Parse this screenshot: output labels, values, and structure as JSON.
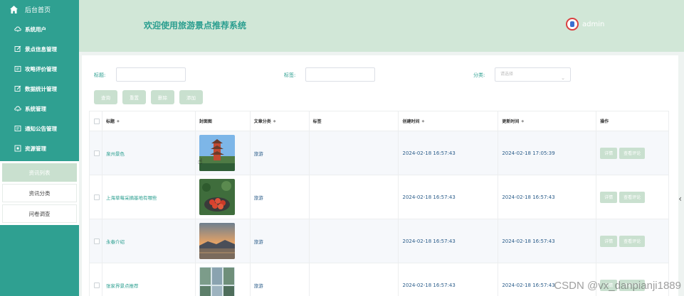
{
  "sidebar": {
    "home": {
      "label": "后台首页",
      "icon": "home-icon"
    },
    "items": [
      {
        "label": "系统用户",
        "icon": "cloud-icon"
      },
      {
        "label": "景点信息管理",
        "icon": "edit-icon"
      },
      {
        "label": "攻略评价管理",
        "icon": "doc-icon"
      },
      {
        "label": "数据统计管理",
        "icon": "edit-icon"
      },
      {
        "label": "系统管理",
        "icon": "cloud-icon"
      },
      {
        "label": "通知公告管理",
        "icon": "doc-icon"
      },
      {
        "label": "资源管理",
        "icon": "box-icon"
      }
    ],
    "sub_items": [
      {
        "label": "资讯列表",
        "active": true
      },
      {
        "label": "资讯分类",
        "active": false
      },
      {
        "label": "问卷调查",
        "active": false
      }
    ]
  },
  "header": {
    "title": "欢迎使用旅游景点推荐系统",
    "user": "admin"
  },
  "filters": {
    "title_label": "标题:",
    "tag_label": "标签:",
    "category_label": "分类:",
    "category_placeholder": "请选择"
  },
  "actions": {
    "query": "查询",
    "reset": "重置",
    "delete": "删除",
    "add": "添加"
  },
  "table": {
    "columns": [
      "标题",
      "封面图",
      "文章分类",
      "标签",
      "创建时间",
      "更新时间",
      "操作"
    ],
    "rows": [
      {
        "title": "泉州景色",
        "category": "旅游",
        "tag": "",
        "created": "2024-02-18 16:57:43",
        "updated": "2024-02-18 17:05:39",
        "cover": "pagoda"
      },
      {
        "title": "上海草莓采摘基地有哪些",
        "category": "旅游",
        "tag": "",
        "created": "2024-02-18 16:57:43",
        "updated": "2024-02-18 16:57:43",
        "cover": "strawberry"
      },
      {
        "title": "永春介绍",
        "category": "旅游",
        "tag": "",
        "created": "2024-02-18 16:57:43",
        "updated": "2024-02-18 16:57:43",
        "cover": "sunset"
      },
      {
        "title": "张家界景点推荐",
        "category": "旅游",
        "tag": "",
        "created": "2024-02-18 16:57:43",
        "updated": "2024-02-18 16:57:43",
        "cover": "mountains"
      }
    ],
    "row_actions": {
      "detail": "详情",
      "view_comments": "查看评论"
    }
  },
  "watermark": "CSDN @vx_danpianji1889",
  "colors": {
    "accent": "#2fa091",
    "header_bg": "#d1e7d7",
    "button_bg": "#c9e0cf"
  }
}
